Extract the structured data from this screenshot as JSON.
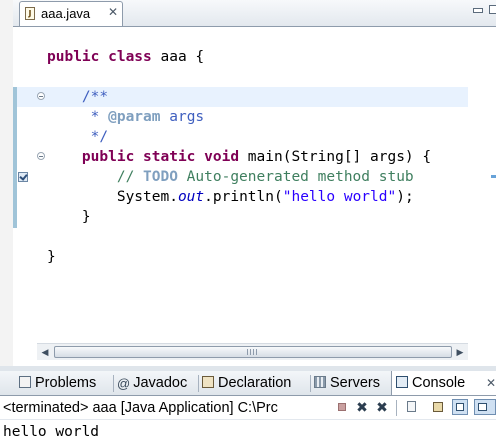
{
  "editor": {
    "tab_label": "aaa.java",
    "tab_close": "✕",
    "code_lines": [
      [
        {
          "t": "public ",
          "c": "kw"
        },
        {
          "t": "class ",
          "c": "kw"
        },
        {
          "t": "aaa {",
          "c": ""
        }
      ],
      [],
      [
        {
          "t": "    /**",
          "c": "jd"
        }
      ],
      [
        {
          "t": "     * ",
          "c": "jd"
        },
        {
          "t": "@param",
          "c": "jd-tag"
        },
        {
          "t": " args",
          "c": "jd"
        }
      ],
      [
        {
          "t": "     */",
          "c": "jd"
        }
      ],
      [
        {
          "t": "    ",
          "c": ""
        },
        {
          "t": "public ",
          "c": "kw"
        },
        {
          "t": "static ",
          "c": "kw"
        },
        {
          "t": "void ",
          "c": "kw"
        },
        {
          "t": "main(String[] args) {",
          "c": ""
        }
      ],
      [
        {
          "t": "        // ",
          "c": "cm"
        },
        {
          "t": "TODO",
          "c": "todo"
        },
        {
          "t": " Auto-generated method stub",
          "c": "cm"
        }
      ],
      [
        {
          "t": "        System.",
          "c": ""
        },
        {
          "t": "out",
          "c": "field"
        },
        {
          "t": ".println(",
          "c": ""
        },
        {
          "t": "\"hello world\"",
          "c": "str"
        },
        {
          "t": ");",
          "c": ""
        }
      ],
      [
        {
          "t": "    }",
          "c": ""
        }
      ],
      [],
      [
        {
          "t": "}",
          "c": ""
        }
      ]
    ],
    "scroll_left": "◀",
    "scroll_right": "▶"
  },
  "panel": {
    "tabs": {
      "problems": "Problems",
      "javadoc_icon": "@",
      "javadoc": "Javadoc",
      "declaration": "Declaration",
      "servers": "Servers",
      "console": "Console"
    },
    "console_close": "✕",
    "console_title": "<terminated> aaa [Java Application] C:\\Prc",
    "remove_launch_glyph": "✖",
    "remove_all_glyph": "✖",
    "output": "hello world"
  }
}
